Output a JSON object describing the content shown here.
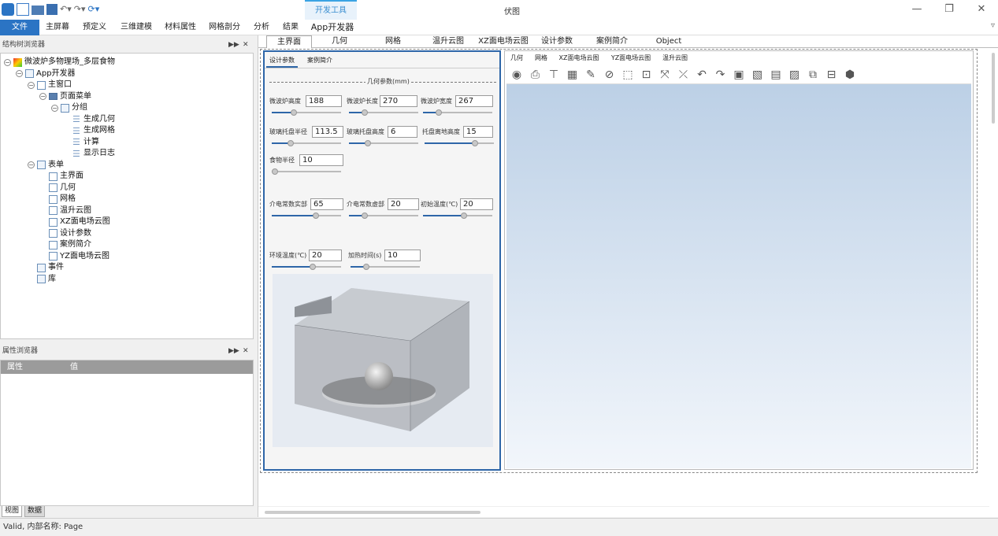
{
  "window": {
    "title": "伏图",
    "dev_tab": "开发工具"
  },
  "menu": [
    "文件",
    "主屏幕",
    "预定义",
    "三维建模",
    "材料属性",
    "网格剖分",
    "分析",
    "结果",
    "App开发器"
  ],
  "tree_panel": {
    "title": "结构树浏览器"
  },
  "tree": [
    {
      "label": "微波炉多物理场_多层食物",
      "level": 0,
      "toggle": "−",
      "icon": "model-icon"
    },
    {
      "label": "App开发器",
      "level": 1,
      "toggle": "−",
      "icon": "app-icon"
    },
    {
      "label": "主窗口",
      "level": 2,
      "toggle": "−",
      "icon": "window-icon"
    },
    {
      "label": "页面菜单",
      "level": 3,
      "toggle": "−",
      "icon": "folder-icon"
    },
    {
      "label": "分组",
      "level": 4,
      "toggle": "−",
      "icon": "group-icon"
    },
    {
      "label": "生成几何",
      "level": 5,
      "toggle": "",
      "icon": "list-icon"
    },
    {
      "label": "生成网格",
      "level": 5,
      "toggle": "",
      "icon": "list-icon"
    },
    {
      "label": "计算",
      "level": 5,
      "toggle": "",
      "icon": "list-icon"
    },
    {
      "label": "显示日志",
      "level": 5,
      "toggle": "",
      "icon": "list-icon"
    },
    {
      "label": "表单",
      "level": 2,
      "toggle": "−",
      "icon": "form-folder-icon"
    },
    {
      "label": "主界面",
      "level": 3,
      "toggle": "",
      "icon": "form-icon"
    },
    {
      "label": "几何",
      "level": 3,
      "toggle": "",
      "icon": "form-icon"
    },
    {
      "label": "网格",
      "level": 3,
      "toggle": "",
      "icon": "form-icon"
    },
    {
      "label": "温升云图",
      "level": 3,
      "toggle": "",
      "icon": "form-icon"
    },
    {
      "label": "XZ面电场云图",
      "level": 3,
      "toggle": "",
      "icon": "form-icon"
    },
    {
      "label": "设计参数",
      "level": 3,
      "toggle": "",
      "icon": "form-icon"
    },
    {
      "label": "案例简介",
      "level": 3,
      "toggle": "",
      "icon": "form-icon"
    },
    {
      "label": "YZ面电场云图",
      "level": 3,
      "toggle": "",
      "icon": "form-icon"
    },
    {
      "label": "事件",
      "level": 2,
      "toggle": "",
      "icon": "event-icon"
    },
    {
      "label": "库",
      "level": 2,
      "toggle": "",
      "icon": "library-icon"
    }
  ],
  "property_panel": {
    "title": "属性浏览器",
    "col_property": "属性",
    "col_value": "值"
  },
  "bottom_tabs": [
    "视图",
    "数据"
  ],
  "status": "Valid, 内部名称: Page",
  "page_tabs": [
    "主界面",
    "几何",
    "网格",
    "温升云图",
    "XZ面电场云图",
    "设计参数",
    "案例简介",
    "Object"
  ],
  "form": {
    "tabs": [
      "设计参数",
      "案例简介"
    ],
    "section_title": "几何参数(mm)",
    "fields": [
      {
        "label": "微波炉高度",
        "value": "188",
        "slider": 0.3
      },
      {
        "label": "微波炉长度",
        "value": "270",
        "slider": 0.2
      },
      {
        "label": "微波炉宽度",
        "value": "267",
        "slider": 0.2
      },
      {
        "label": "玻璃托盘半径",
        "value": "113.5",
        "slider": 0.25
      },
      {
        "label": "玻璃托盘高度",
        "value": "6",
        "slider": 0.25
      },
      {
        "label": "托盘离地高度",
        "value": "15",
        "slider": 0.75
      },
      {
        "label": "食物半径",
        "value": "10",
        "slider": 0.0
      },
      {
        "label": "介电常数实部",
        "value": "65",
        "slider": 0.65
      },
      {
        "label": "介电常数虚部",
        "value": "20",
        "slider": 0.2
      },
      {
        "label": "初始温度(℃)",
        "value": "20",
        "slider": 0.6
      },
      {
        "label": "环境温度(℃)",
        "value": "20",
        "slider": 0.6
      },
      {
        "label": "加热时间(s)",
        "value": "10",
        "slider": 0.2
      }
    ]
  },
  "viewer": {
    "tabs": [
      "几何",
      "网格",
      "XZ面电场云图",
      "YZ面电场云图",
      "温升云图"
    ],
    "tools": [
      "capture-icon",
      "print-icon",
      "axis-icon",
      "grid-icon",
      "pan-icon",
      "hide-icon",
      "zoom-box-icon",
      "zoom-fit-icon",
      "rotate-icon",
      "center-icon",
      "undo-icon",
      "redo-icon",
      "view-front-icon",
      "view-side-icon",
      "view-top-icon",
      "view-slice-icon",
      "view-iso-icon",
      "view-back-icon",
      "view-3d-icon"
    ]
  }
}
